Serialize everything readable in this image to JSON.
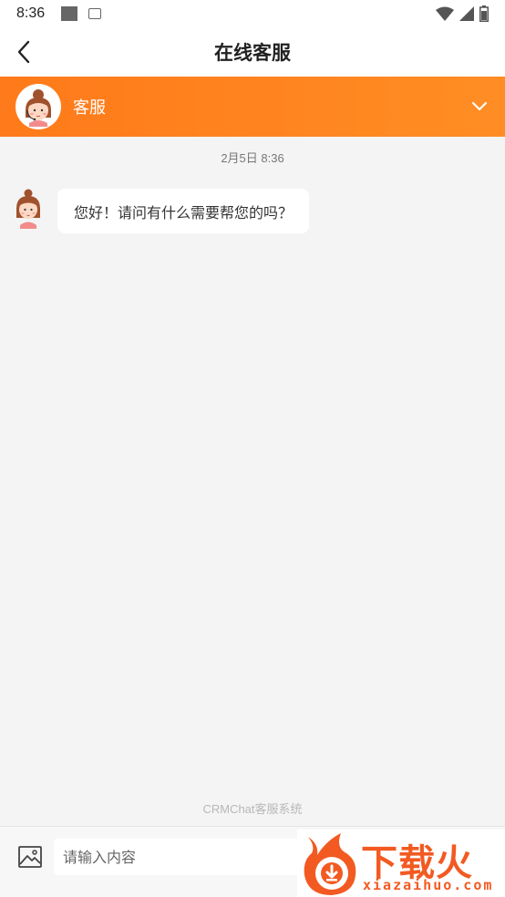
{
  "status_bar": {
    "time": "8:36",
    "icons": [
      "notification-square-icon",
      "app-notification-icon",
      "wifi-icon",
      "signal-icon",
      "battery-icon"
    ]
  },
  "header": {
    "title": "在线客服",
    "back_icon": "chevron-left-icon"
  },
  "agent": {
    "name": "客服",
    "accent_color": "#ff7f1e"
  },
  "chat": {
    "timestamp": "2月5日 8:36",
    "messages": [
      {
        "sender": "agent",
        "text": "您好！请问有什么需要帮您的吗？"
      }
    ],
    "powered_by": "CRMChat客服系统"
  },
  "composer": {
    "placeholder": "请输入内容",
    "value": ""
  },
  "watermark": {
    "text": "下载火",
    "domain": "xiazaihuo.com"
  }
}
